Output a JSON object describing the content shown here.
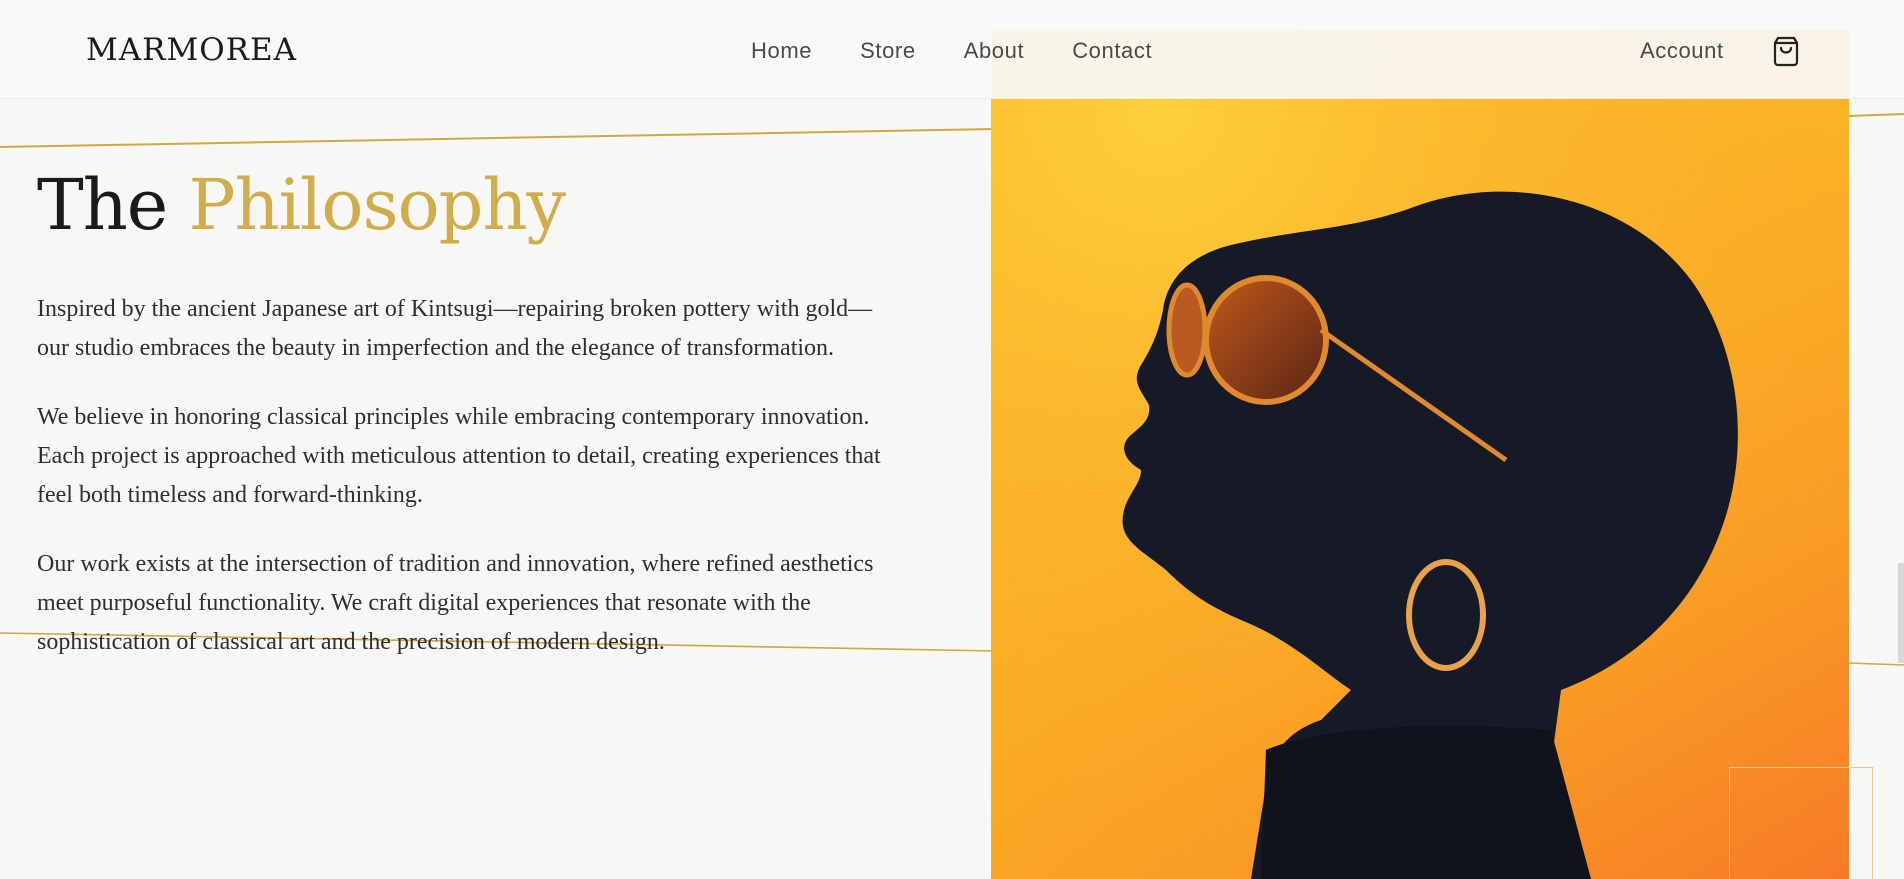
{
  "header": {
    "brand": "MARMOREA",
    "nav": [
      {
        "label": "Home"
      },
      {
        "label": "Store"
      },
      {
        "label": "About"
      },
      {
        "label": "Contact"
      }
    ],
    "account_label": "Account",
    "cart_icon": "shopping-bag-icon"
  },
  "main": {
    "title_lead": "The",
    "title_accent": "Philosophy",
    "paragraphs": [
      "Inspired by the ancient Japanese art of Kintsugi—repairing broken pottery with gold—our studio embraces the beauty in imperfection and the elegance of transformation.",
      "We believe in honoring classical principles while embracing contemporary innovation. Each project is approached with meticulous attention to detail, creating experiences that feel both timeless and forward-thinking.",
      "Our work exists at the intersection of tradition and innovation, where refined aesthetics meet purposeful functionality. We craft digital experiences that resonate with the sophistication of classical art and the precision of modern design."
    ]
  },
  "colors": {
    "accent_gold": "#d0ac4a",
    "background": "#f7f7f5",
    "hero_orange": "#f9a825",
    "text_dark": "#1a1a1a"
  }
}
